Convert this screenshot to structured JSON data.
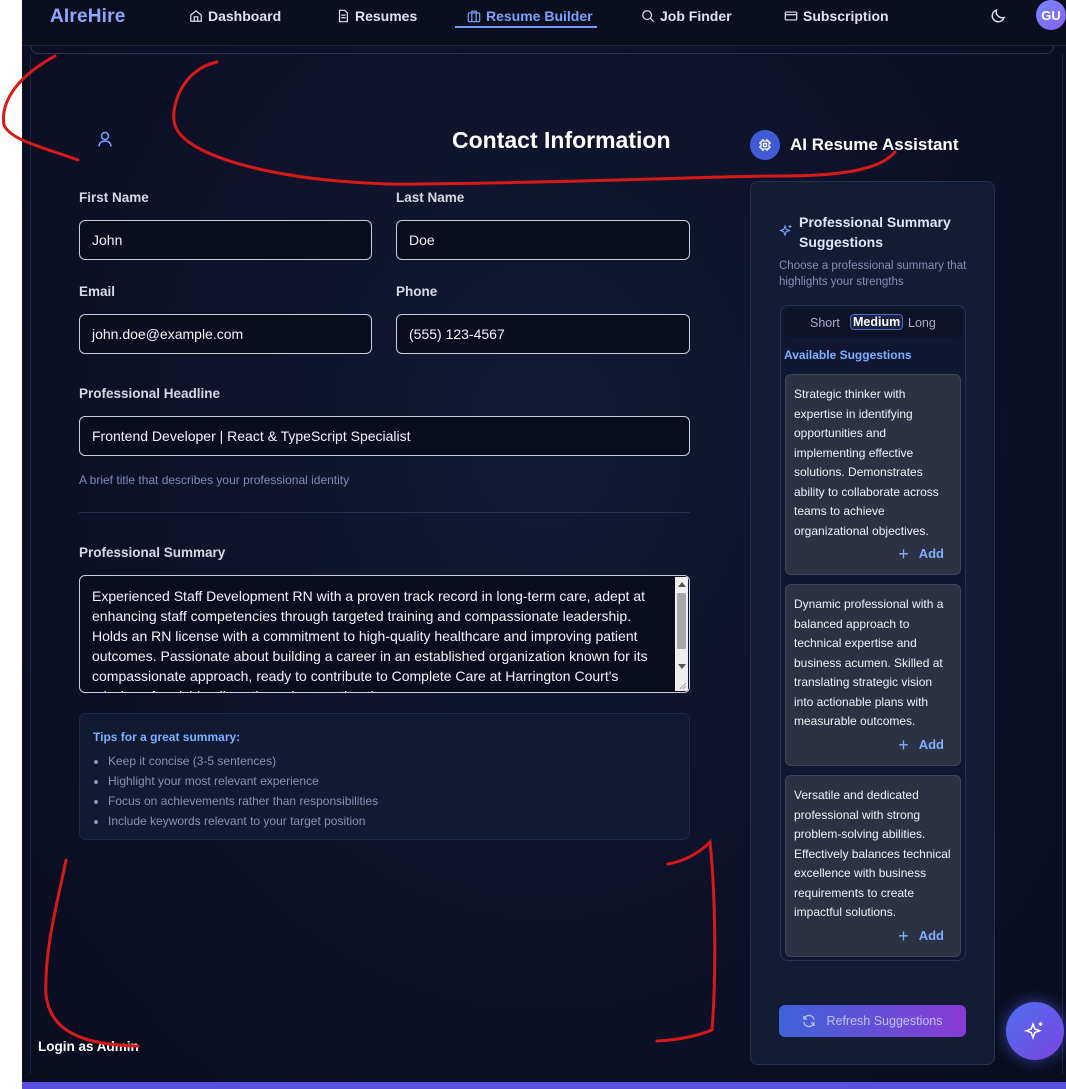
{
  "nav": {
    "brand": "AIreHire",
    "items": [
      {
        "label": "Dashboard",
        "icon": "home-icon"
      },
      {
        "label": "Resumes",
        "icon": "file-icon"
      },
      {
        "label": "Resume Builder",
        "icon": "briefcase-icon",
        "active": true
      },
      {
        "label": "Job Finder",
        "icon": "search-icon"
      },
      {
        "label": "Subscription",
        "icon": "card-icon"
      }
    ],
    "theme_icon": "moon-icon",
    "avatar_initials": "GU"
  },
  "form": {
    "title": "Contact Information",
    "first_name": {
      "label": "First Name",
      "value": "John"
    },
    "last_name": {
      "label": "Last Name",
      "value": "Doe"
    },
    "email": {
      "label": "Email",
      "value": "john.doe@example.com"
    },
    "phone": {
      "label": "Phone",
      "value": "(555) 123-4567"
    },
    "headline": {
      "label": "Professional Headline",
      "value": "Frontend Developer | React & TypeScript Specialist",
      "hint": "A brief title that describes your professional identity"
    },
    "summary": {
      "label": "Professional Summary",
      "value": "Experienced Staff Development RN with a proven track record in long-term care, adept at enhancing staff competencies through targeted training and compassionate leadership. Holds an RN license with a commitment to high-quality healthcare and improving patient outcomes. Passionate about building a career in an established organization known for its compassionate approach, ready to contribute to Complete Care at Harrington Court's mission of enriching lives through exceptional care."
    },
    "tips": {
      "title": "Tips for a great summary:",
      "items": [
        "Keep it concise (3-5 sentences)",
        "Highlight your most relevant experience",
        "Focus on achievements rather than responsibilities",
        "Include keywords relevant to your target position"
      ]
    }
  },
  "assistant": {
    "title": "AI Resume Assistant",
    "section_title": "Professional Summary Suggestions",
    "section_desc": "Choose a professional summary that highlights your strengths",
    "tabs": [
      "Short",
      "Medium",
      "Long"
    ],
    "active_tab": "Medium",
    "available_label": "Available Suggestions",
    "add_label": "Add",
    "suggestions": [
      "Strategic thinker with expertise in identifying opportunities and implementing effective solutions. Demonstrates ability to collaborate across teams to achieve organizational objectives.",
      "Dynamic professional with a balanced approach to technical expertise and business acumen. Skilled at translating strategic vision into actionable plans with measurable outcomes.",
      "Versatile and dedicated professional with strong problem-solving abilities. Effectively balances technical excellence with business requirements to create impactful solutions."
    ],
    "refresh_label": "Refresh Suggestions"
  },
  "footer": {
    "login_admin": "Login as Admin"
  },
  "colors": {
    "accent": "#7aa2ff",
    "annotation_red": "#d61a1a",
    "button_gradient_start": "#3e63d8",
    "button_gradient_end": "#8a3ad6"
  }
}
